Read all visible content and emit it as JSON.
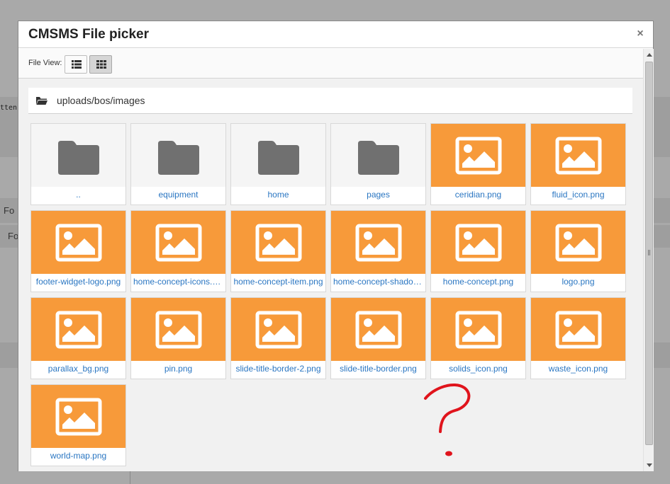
{
  "background": {
    "snippet_1": "tten",
    "snippet_2": "Fo",
    "snippet_3": "Fo"
  },
  "dialog": {
    "title": "CMSMS File picker",
    "close_symbol": "×"
  },
  "toolbar": {
    "file_view_label": "File View:",
    "list_view_icon": "list-icon",
    "grid_view_icon": "grid-icon",
    "active_view": "grid"
  },
  "path": {
    "icon": "folder-open-icon",
    "text": "uploads/bos/images"
  },
  "files": [
    {
      "name": "..",
      "type": "folder"
    },
    {
      "name": "equipment",
      "type": "folder"
    },
    {
      "name": "home",
      "type": "folder"
    },
    {
      "name": "pages",
      "type": "folder"
    },
    {
      "name": "ceridian.png",
      "type": "image"
    },
    {
      "name": "fluid_icon.png",
      "type": "image"
    },
    {
      "name": "footer-widget-logo.png",
      "type": "image"
    },
    {
      "name": "home-concept-icons.png",
      "type": "image"
    },
    {
      "name": "home-concept-item.png",
      "type": "image"
    },
    {
      "name": "home-concept-shadow.png",
      "type": "image"
    },
    {
      "name": "home-concept.png",
      "type": "image"
    },
    {
      "name": "logo.png",
      "type": "image"
    },
    {
      "name": "parallax_bg.png",
      "type": "image"
    },
    {
      "name": "pin.png",
      "type": "image"
    },
    {
      "name": "slide-title-border-2.png",
      "type": "image"
    },
    {
      "name": "slide-title-border.png",
      "type": "image"
    },
    {
      "name": "solids_icon.png",
      "type": "image"
    },
    {
      "name": "waste_icon.png",
      "type": "image"
    },
    {
      "name": "world-map.png",
      "type": "image"
    }
  ],
  "colors": {
    "image_thumb": "#f79a3a",
    "folder_icon": "#707070",
    "link": "#2a76c2",
    "annotation": "#e0141c"
  },
  "annotation": {
    "icon": "question-mark-scribble-icon"
  }
}
